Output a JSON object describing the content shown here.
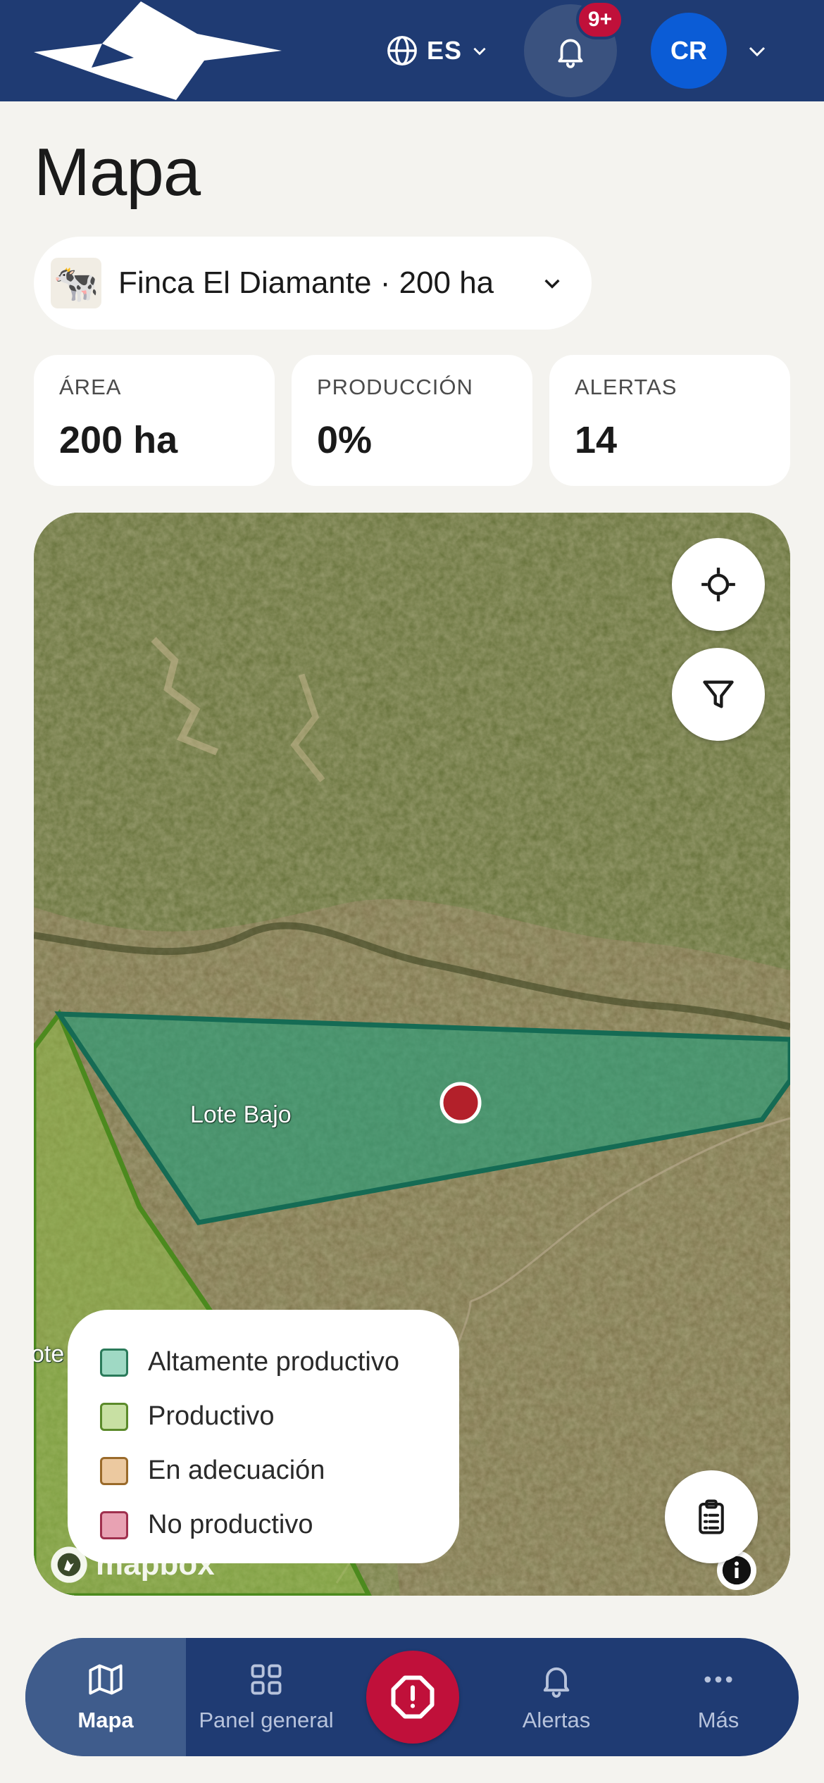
{
  "header": {
    "language_code": "ES",
    "notifications_badge": "9+",
    "user_initials": "CR"
  },
  "page": {
    "title": "Mapa"
  },
  "farm_selector": {
    "emoji": "🐄",
    "label": "Finca El Diamante · 200 ha"
  },
  "stats": [
    {
      "label": "ÁREA",
      "value": "200 ha"
    },
    {
      "label": "PRODUCCIÓN",
      "value": "0%"
    },
    {
      "label": "ALERTAS",
      "value": "14"
    }
  ],
  "map": {
    "lots": [
      {
        "name": "Lote Bajo"
      },
      {
        "name": "ote"
      }
    ],
    "legend": [
      {
        "label": "Altamente productivo",
        "fill": "#9fd9c4",
        "stroke": "#2a7a5a"
      },
      {
        "label": "Productivo",
        "fill": "#c8e0a3",
        "stroke": "#5b8a2a"
      },
      {
        "label": "En adecuación",
        "fill": "#ecc9a0",
        "stroke": "#9a6a2a"
      },
      {
        "label": "No productivo",
        "fill": "#e8a2b3",
        "stroke": "#a0304e"
      }
    ],
    "attribution": "mapbox"
  },
  "nav": {
    "items": [
      {
        "label": "Mapa",
        "icon": "map-icon"
      },
      {
        "label": "Panel general",
        "icon": "dashboard-icon"
      },
      {
        "label": "Alertas",
        "icon": "bell-icon"
      },
      {
        "label": "Más",
        "icon": "more-icon"
      }
    ],
    "sos_icon": "alert-octagon-icon"
  },
  "colors": {
    "brand_navy": "#1f3b73",
    "accent_red": "#c0103a",
    "avatar_blue": "#0b5cd6",
    "background": "#f4f3ef"
  }
}
